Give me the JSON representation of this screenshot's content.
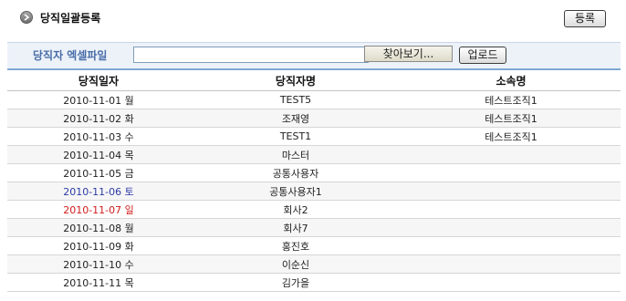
{
  "header": {
    "title": "당직일괄등록",
    "register_label": "등록"
  },
  "upload": {
    "label": "당직자 엑셀파일",
    "file_value": "",
    "browse_label": "찾아보기...",
    "upload_label": "업로드"
  },
  "table": {
    "columns": [
      "당직일자",
      "당직자명",
      "소속명"
    ],
    "rows": [
      {
        "date": "2010-11-01 월",
        "name": "TEST5",
        "org": "테스트조직1",
        "day": "weekday"
      },
      {
        "date": "2010-11-02 화",
        "name": "조재영",
        "org": "테스트조직1",
        "day": "weekday"
      },
      {
        "date": "2010-11-03 수",
        "name": "TEST1",
        "org": "테스트조직1",
        "day": "weekday"
      },
      {
        "date": "2010-11-04 목",
        "name": "마스터",
        "org": "",
        "day": "weekday"
      },
      {
        "date": "2010-11-05 금",
        "name": "공통사용자",
        "org": "",
        "day": "weekday"
      },
      {
        "date": "2010-11-06 토",
        "name": "공통사용자1",
        "org": "",
        "day": "saturday"
      },
      {
        "date": "2010-11-07 일",
        "name": "회사2",
        "org": "",
        "day": "sunday"
      },
      {
        "date": "2010-11-08 월",
        "name": "회사7",
        "org": "",
        "day": "weekday"
      },
      {
        "date": "2010-11-09 화",
        "name": "홍진호",
        "org": "",
        "day": "weekday"
      },
      {
        "date": "2010-11-10 수",
        "name": "이순신",
        "org": "",
        "day": "weekday"
      },
      {
        "date": "2010-11-11 목",
        "name": "김가을",
        "org": "",
        "day": "weekday"
      }
    ]
  },
  "colors": {
    "saturday": "#2c3aa6",
    "sunday": "#d01b1b",
    "upload_label": "#4a6ea8",
    "header_rule": "#7fa7d6"
  },
  "icons": {
    "title_icon": "chevron-right-circle-icon"
  }
}
